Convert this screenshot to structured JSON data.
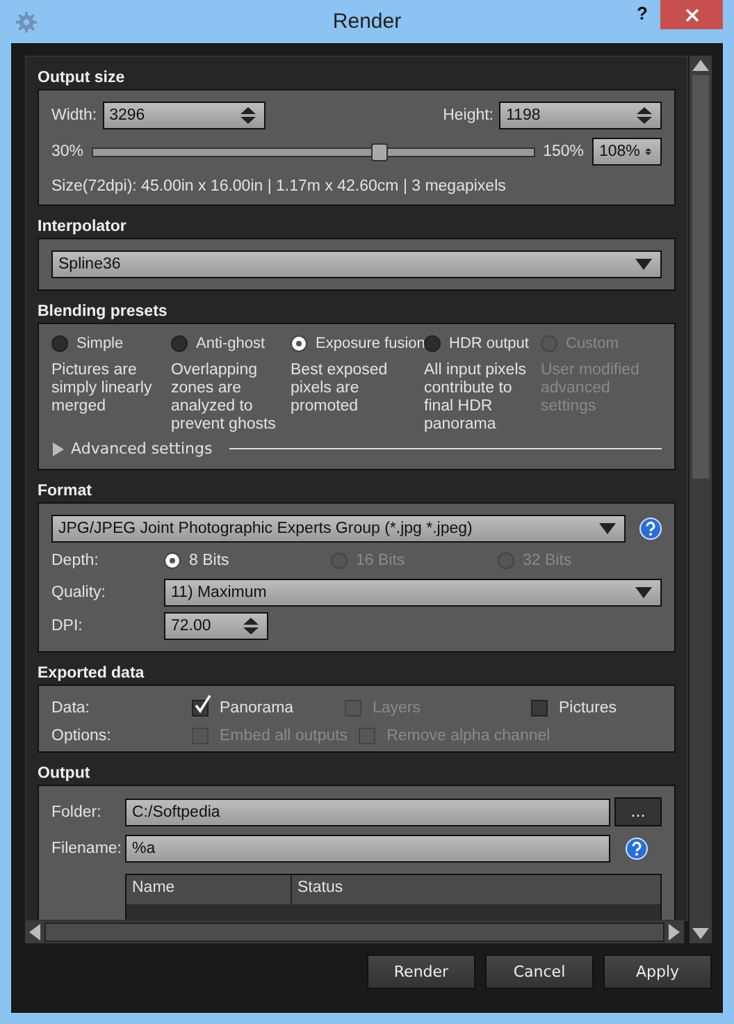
{
  "window": {
    "title": "Render",
    "help": "?"
  },
  "output_size": {
    "title": "Output size",
    "width_label": "Width:",
    "width_value": "3296",
    "height_label": "Height:",
    "height_value": "1198",
    "scale_min": "30%",
    "scale_max": "150%",
    "scale_value": "108%",
    "scale": {
      "level": 0.65
    },
    "size_info": "Size(72dpi): 45.00in x 16.00in |  1.17m x 42.60cm | 3 megapixels"
  },
  "interpolator": {
    "title": "Interpolator",
    "value": "Spline36"
  },
  "blending": {
    "title": "Blending presets",
    "presets": [
      {
        "label": "Simple",
        "description": "Pictures are simply linearly merged",
        "selected": false,
        "disabled": false
      },
      {
        "label": "Anti-ghost",
        "description": "Overlapping zones are analyzed to prevent ghosts",
        "selected": false,
        "disabled": false
      },
      {
        "label": "Exposure fusion",
        "description": "Best exposed pixels are promoted",
        "selected": true,
        "disabled": false
      },
      {
        "label": "HDR output",
        "description": "All input pixels contribute to final HDR panorama",
        "selected": false,
        "disabled": false
      },
      {
        "label": "Custom",
        "description": "User modified advanced settings",
        "selected": false,
        "disabled": true
      }
    ],
    "advanced": {
      "label": "Advanced settings",
      "expanded": false
    }
  },
  "format": {
    "title": "Format",
    "value": "JPG/JPEG Joint Photographic Experts Group (*.jpg *.jpeg)",
    "depth_label": "Depth:",
    "depths": [
      {
        "label": "8 Bits",
        "selected": true,
        "disabled": false
      },
      {
        "label": "16 Bits",
        "selected": false,
        "disabled": true
      },
      {
        "label": "32 Bits",
        "selected": false,
        "disabled": true
      }
    ],
    "quality_label": "Quality:",
    "quality_value": "11) Maximum",
    "dpi_label": "DPI:",
    "dpi_value": "72.00"
  },
  "exported": {
    "title": "Exported data",
    "data_label": "Data:",
    "data": [
      {
        "label": "Panorama",
        "checked": true,
        "disabled": false
      },
      {
        "label": "Layers",
        "checked": false,
        "disabled": true
      },
      {
        "label": "Pictures",
        "checked": false,
        "disabled": false
      }
    ],
    "options_label": "Options:",
    "options": [
      {
        "label": "Embed all outputs",
        "checked": false,
        "disabled": true
      },
      {
        "label": "Remove alpha channel",
        "checked": false,
        "disabled": true
      }
    ]
  },
  "output": {
    "title": "Output",
    "folder_label": "Folder:",
    "folder_value": "C:/Softpedia",
    "browse": "...",
    "filename_label": "Filename:",
    "filename_value": "%a",
    "table": {
      "columns": [
        "Name",
        "Status"
      ]
    }
  },
  "buttons": [
    {
      "label": "Render"
    },
    {
      "label": "Cancel"
    },
    {
      "label": "Apply"
    }
  ]
}
